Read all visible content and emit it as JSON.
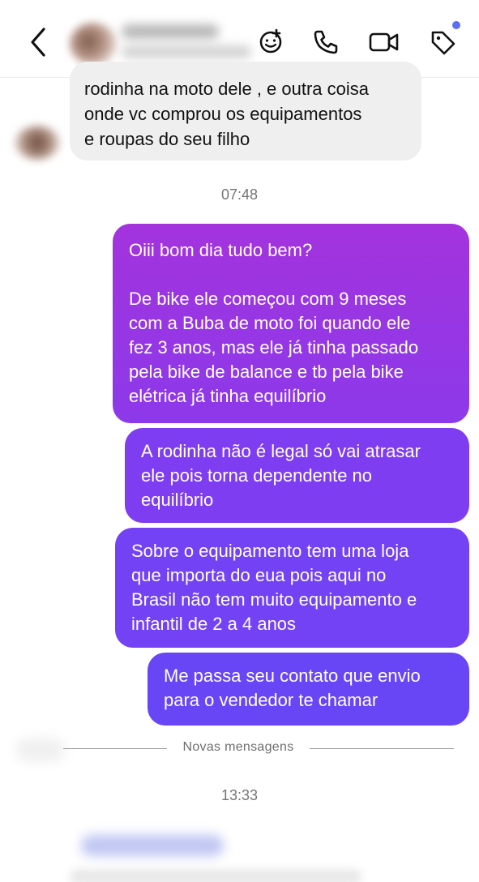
{
  "header": {
    "back_icon": "chevron-left-icon",
    "contact_avatar": "blurred",
    "actions": [
      {
        "name": "effects-icon"
      },
      {
        "name": "phone-icon"
      },
      {
        "name": "video-icon"
      },
      {
        "name": "tag-icon"
      }
    ],
    "notification_color": "#5b6cf5"
  },
  "messages": {
    "incoming_text": "rodinha na moto dele , e outra coisa\nonde vc comprou os equipamentos\ne roupas do seu filho",
    "time_1": "07:48",
    "outgoing": [
      {
        "text": "Oiii bom dia tudo bem?\n\nDe bike ele começou com 9 meses\ncom a Buba de moto foi quando ele\nfez 3 anos, mas ele já tinha passado\npela bike de balance e tb  pela bike\nelétrica já tinha equilíbrio"
      },
      {
        "text": "A rodinha não é legal só vai atrasar\nele pois torna dependente no\nequilíbrio"
      },
      {
        "text": "Sobre o equipamento tem uma loja\nque importa do eua pois aqui no\nBrasil não tem muito equipamento e\ninfantil de 2 a 4 anos"
      },
      {
        "text": "Me passa seu contato que envio\npara o vendedor te chamar"
      }
    ],
    "divider_label": "Novas mensagens",
    "time_2": "13:33"
  },
  "colors": {
    "bubble_gradient_top": "#a333dd",
    "bubble_gradient_bottom": "#6846f5",
    "incoming_bg": "#efefef"
  }
}
